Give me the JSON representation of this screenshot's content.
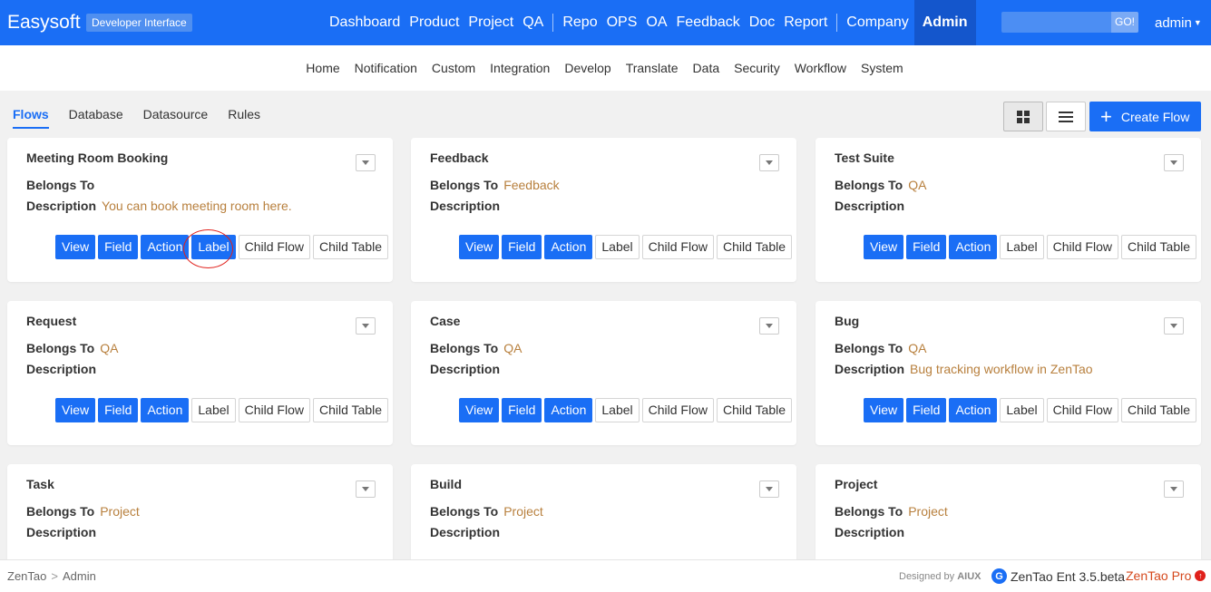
{
  "header": {
    "brand": "Easysoft",
    "badge": "Developer Interface",
    "nav_group1": [
      "Dashboard",
      "Product",
      "Project",
      "QA"
    ],
    "nav_group2": [
      "Repo",
      "OPS",
      "OA",
      "Feedback",
      "Doc",
      "Report"
    ],
    "nav_group3": [
      "Company"
    ],
    "nav_active": "Admin",
    "search_placeholder": "",
    "go_label": "GO!",
    "user": "admin"
  },
  "subnav": [
    "Home",
    "Notification",
    "Custom",
    "Integration",
    "Develop",
    "Translate",
    "Data",
    "Security",
    "Workflow",
    "System"
  ],
  "tabs": {
    "active": "Flows",
    "items": [
      "Database",
      "Datasource",
      "Rules"
    ]
  },
  "toolbar": {
    "grid_icon": "grid-view-icon",
    "list_icon": "list-view-icon",
    "create_label": "Create Flow",
    "create_icon": "+"
  },
  "labels": {
    "belongs_to": "Belongs To",
    "description": "Description",
    "btn_view": "View",
    "btn_field": "Field",
    "btn_action": "Action",
    "btn_label": "Label",
    "btn_child_flow": "Child Flow",
    "btn_child_table": "Child Table"
  },
  "flows": [
    {
      "name": "Meeting Room Booking",
      "belongs_to": "",
      "description": "You can book meeting room here.",
      "label_active": true
    },
    {
      "name": "Feedback",
      "belongs_to": "Feedback",
      "description": "",
      "label_active": false
    },
    {
      "name": "Test Suite",
      "belongs_to": "QA",
      "description": "",
      "label_active": false
    },
    {
      "name": "Request",
      "belongs_to": "QA",
      "description": "",
      "label_active": false
    },
    {
      "name": "Case",
      "belongs_to": "QA",
      "description": "",
      "label_active": false
    },
    {
      "name": "Bug",
      "belongs_to": "QA",
      "description": "Bug tracking workflow in ZenTao",
      "label_active": false
    },
    {
      "name": "Task",
      "belongs_to": "Project",
      "description": "",
      "label_active": false
    },
    {
      "name": "Build",
      "belongs_to": "Project",
      "description": "",
      "label_active": false
    },
    {
      "name": "Project",
      "belongs_to": "Project",
      "description": "",
      "label_active": false
    }
  ],
  "footer": {
    "crumb_root": "ZenTao",
    "crumb_sep": ">",
    "crumb_current": "Admin",
    "designed_by": "Designed by",
    "designer": "AIUX",
    "version": "ZenTao Ent 3.5.beta",
    "pro_link": "ZenTao Pro"
  },
  "colors": {
    "primary": "#1a6ef5",
    "value_text": "#b8803e",
    "annotation_ring": "#e0201b"
  }
}
